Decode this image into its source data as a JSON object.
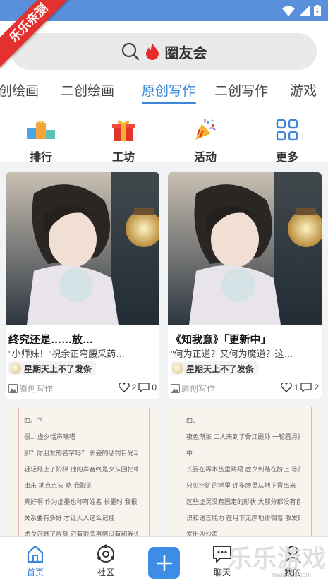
{
  "watermark_ribbon": "乐乐亲测",
  "search": {
    "label": "圈友会"
  },
  "tabs": [
    {
      "label": "创绘画"
    },
    {
      "label": "二创绘画"
    },
    {
      "label": "原创写作",
      "active": true
    },
    {
      "label": "二创写作"
    },
    {
      "label": "游戏"
    }
  ],
  "shortcuts": [
    {
      "label": "排行",
      "icon": "podium-icon"
    },
    {
      "label": "工坊",
      "icon": "gift-icon"
    },
    {
      "label": "活动",
      "icon": "party-popper-icon"
    },
    {
      "label": "更多",
      "icon": "grid-icon"
    }
  ],
  "posts": [
    {
      "title": "终究还是……放…",
      "excerpt": "\"小师妹！\"祝余正弯腰采药…",
      "author": "星期天上不了发条",
      "category": "原创写作",
      "likes": "2",
      "comments": "0"
    },
    {
      "title": "《知我意》「更新中」",
      "excerpt": "\"何为正道？又何为魔道？这…",
      "author": "星期天上不了发条",
      "category": "原创写作",
      "likes": "1",
      "comments": "2"
    }
  ],
  "paper_left_lines": [
    "四、下",
    "很... 虚夕恬声嘀嗒",
    "那？你朋友的名字吗？ 长晏的惩罚目光动了动",
    "轻轻踏上了阶梯 他的声音终是夕从回忆中拉了",
    "出来 地点点头 略 我取的",
    "真好啊 作为虚晏也称有姓名 长晏时 我很好吾",
    "关系要有多好 才让大人这么记挂",
    "虚夕沉默了片刻 它有很多事情没有和我说过 它",
    "的问题我也不知道怎么回答",
    "长晏拂袖唱着 什么问题？ 我可以知道——"
  ],
  "paper_right_lines": [
    "四、",
    "夜色渐浓 二人来到了骨江殿外 一轮圆月挂在空",
    "中",
    "长晏在霖木丛里踌躇 虚夕到踏在阶上 等待着",
    "只见空旷的地里 许多虚灵从地下冒出来",
    "这些虚灵没有固定的形状 大部分都没有自我意",
    "识和语言能力 在月下无序地徘徊着 散发的荧光",
    "发出沙沙声",
    "",
    "在漫长的岁月中 虚灵几乎没有进化过 当其他的"
  ],
  "nav": [
    {
      "label": "首页",
      "icon": "home-icon",
      "active": true
    },
    {
      "label": "社区",
      "icon": "community-icon"
    },
    {
      "label": "",
      "icon": "plus-icon"
    },
    {
      "label": "聊天",
      "icon": "chat-icon"
    },
    {
      "label": "我的",
      "icon": "profile-icon"
    }
  ],
  "watermark": {
    "big": "乐乐游戏",
    "small": "www.61ll.com"
  },
  "colors": {
    "accent": "#3d87d6",
    "statusbar": "#5a8fdc",
    "ribbon": "#e5312d"
  }
}
